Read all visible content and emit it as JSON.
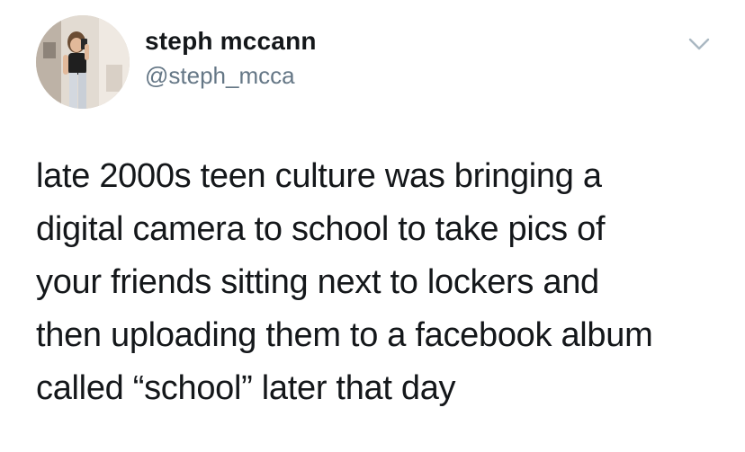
{
  "tweet": {
    "author": {
      "display_name": "steph mccann",
      "handle": "@steph_mcca",
      "avatar_icon": "profile-photo"
    },
    "menu_icon": "chevron-down-icon",
    "text": "late 2000s teen culture was bringing a\ndigital camera to school to take pics of\nyour friends sitting next to lockers and\nthen uploading them to a facebook album\ncalled “school” later that day"
  },
  "colors": {
    "text": "#14171a",
    "secondary_text": "#657786",
    "chevron": "#aab8c2",
    "background": "#ffffff"
  }
}
